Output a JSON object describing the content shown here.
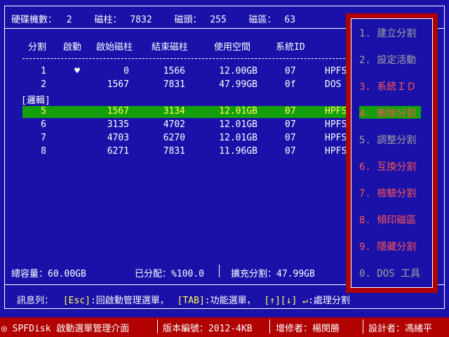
{
  "header": {
    "disks_label": "硬碟機數：",
    "disks_value": "2",
    "cyl_label": "磁柱：",
    "cyl_value": "7832",
    "heads_label": "磁頭：",
    "heads_value": "255",
    "sectors_label": "磁區：",
    "sectors_value": "63"
  },
  "table": {
    "columns": [
      "分割",
      "啟動",
      "啟始磁柱",
      "結束磁柱",
      "使用空間",
      "系統ID"
    ],
    "rows": [
      {
        "idx": "1",
        "boot": "♥",
        "start": "0",
        "end": "1566",
        "size": "12.00GB",
        "sys": "07",
        "type": "HPFS"
      },
      {
        "idx": "2",
        "boot": "",
        "start": "1567",
        "end": "7831",
        "size": "47.99GB",
        "sys": "0f",
        "type": "DOS"
      }
    ],
    "logical_label": "[邏輯]",
    "logical_rows": [
      {
        "idx": "5",
        "boot": "",
        "start": "1567",
        "end": "3134",
        "size": "12.01GB",
        "sys": "07",
        "type": "HPFS"
      },
      {
        "idx": "6",
        "boot": "",
        "start": "3135",
        "end": "4702",
        "size": "12.01GB",
        "sys": "07",
        "type": "HPFS"
      },
      {
        "idx": "7",
        "boot": "",
        "start": "4703",
        "end": "6270",
        "size": "12.01GB",
        "sys": "07",
        "type": "HPFS"
      },
      {
        "idx": "8",
        "boot": "",
        "start": "6271",
        "end": "7831",
        "size": "11.96GB",
        "sys": "07",
        "type": "HPFS"
      }
    ]
  },
  "summary": {
    "total_label": "總容量：",
    "total_value": "60.00GB",
    "allocated_label": "已分配：",
    "allocated_value": "%100.0",
    "extended_label": "擴充分割：",
    "extended_value": "47.99GB"
  },
  "menu": {
    "items": [
      "1. 建立分割",
      "2. 設定活動",
      "3. 系統ＩＤ",
      "4. 刪除分割",
      "5. 調整分割",
      "6. 互換分割",
      "7. 檢驗分割",
      "8. 傾印磁區",
      "9. 隱藏分割",
      "0. DOS 工具"
    ]
  },
  "status": {
    "label": "訊息列：",
    "esc_key": "[Esc]",
    "esc_text": ":回啟動管理選單，",
    "tab_key": "[TAB]",
    "tab_text": ":功能選單，",
    "arrows_key": "[↑][↓] ↵",
    "arrows_text": ":處理分割"
  },
  "footer": {
    "app": "◎ SPFDisk 啟動選單管理介面",
    "version": "版本編號：2012-4KB",
    "author_label": "增修者：楊閔勝",
    "designer_label": "設計者：馮緒平"
  },
  "colors": {
    "background": "#1a12a8",
    "selection": "#14a00c",
    "accent_red": "#b00000",
    "text_yellow": "#ffff55"
  }
}
